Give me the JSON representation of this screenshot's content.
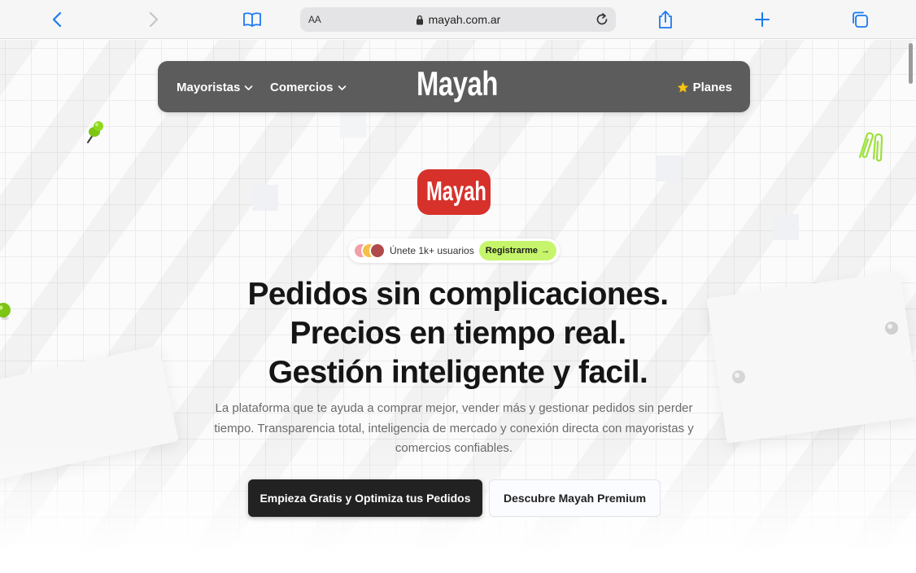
{
  "browser": {
    "address_prefix": "AA",
    "url": "mayah.com.ar",
    "icons": {
      "back": "chevron-left-icon",
      "forward": "chevron-right-icon",
      "bookmarks": "book-icon",
      "secure": "lock-icon",
      "reload": "reload-icon",
      "share": "share-icon",
      "new_tab": "plus-icon",
      "tabs": "tabs-icon"
    }
  },
  "nav": {
    "items": [
      {
        "label": "Mayoristas"
      },
      {
        "label": "Comercios"
      }
    ],
    "logo": "Mayah",
    "planes_label": "Planes"
  },
  "hero": {
    "logo_badge": "Mayah",
    "social_proof": {
      "text": "Únete 1k+ usuarios",
      "cta": "Registrarme",
      "cta_arrow": "→"
    },
    "headline": [
      "Pedidos sin complicaciones.",
      "Precios en tiempo real.",
      "Gestión inteligente y facil."
    ],
    "description": "La plataforma que te ayuda a comprar mejor, vender más y gestionar pedidos sin perder tiempo. Transparencia total, inteligencia de mercado y conexión directa con mayoristas y comercios confiables.",
    "primary_button": "Empieza Gratis y Optimiza tus Pedidos",
    "secondary_button": "Descubre Mayah Premium"
  },
  "colors": {
    "nav_bg": "#5c5c5c",
    "brand_red": "#d7312c",
    "accent_green": "#c6f56b",
    "star": "#f5c518",
    "primary_button": "#222222"
  }
}
